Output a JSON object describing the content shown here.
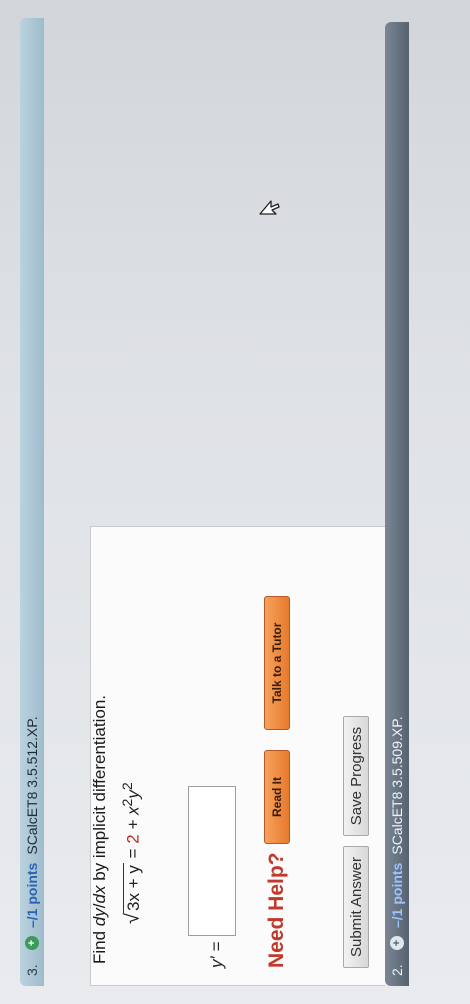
{
  "question3": {
    "number": "3.",
    "points": "–/1 points",
    "code": "SCalcET8 3.5.512.XP."
  },
  "question2": {
    "number": "2.",
    "points": "–/1 points",
    "code": "SCalcET8 3.5.509.XP.",
    "prompt_prefix": "Find ",
    "prompt_var": "dy",
    "prompt_slash": "/",
    "prompt_var2": "dx",
    "prompt_suffix": " by implicit differentiation.",
    "equation": {
      "radicand": "3x + y",
      "equals": " = ",
      "constant": "2",
      "rest": " + x",
      "exp1": "2",
      "y": "y",
      "exp2": "2"
    },
    "answer_label": "y′ =",
    "answer_value": "",
    "need_help": "Need Help?",
    "read_it": "Read It",
    "talk_to_tutor": "Talk to a Tutor",
    "submit": "Submit Answer",
    "save": "Save Progress"
  },
  "colors": {
    "accent_red": "#c0392b",
    "points_blue": "#2a62b6",
    "help_orange": "#e67a2e"
  }
}
